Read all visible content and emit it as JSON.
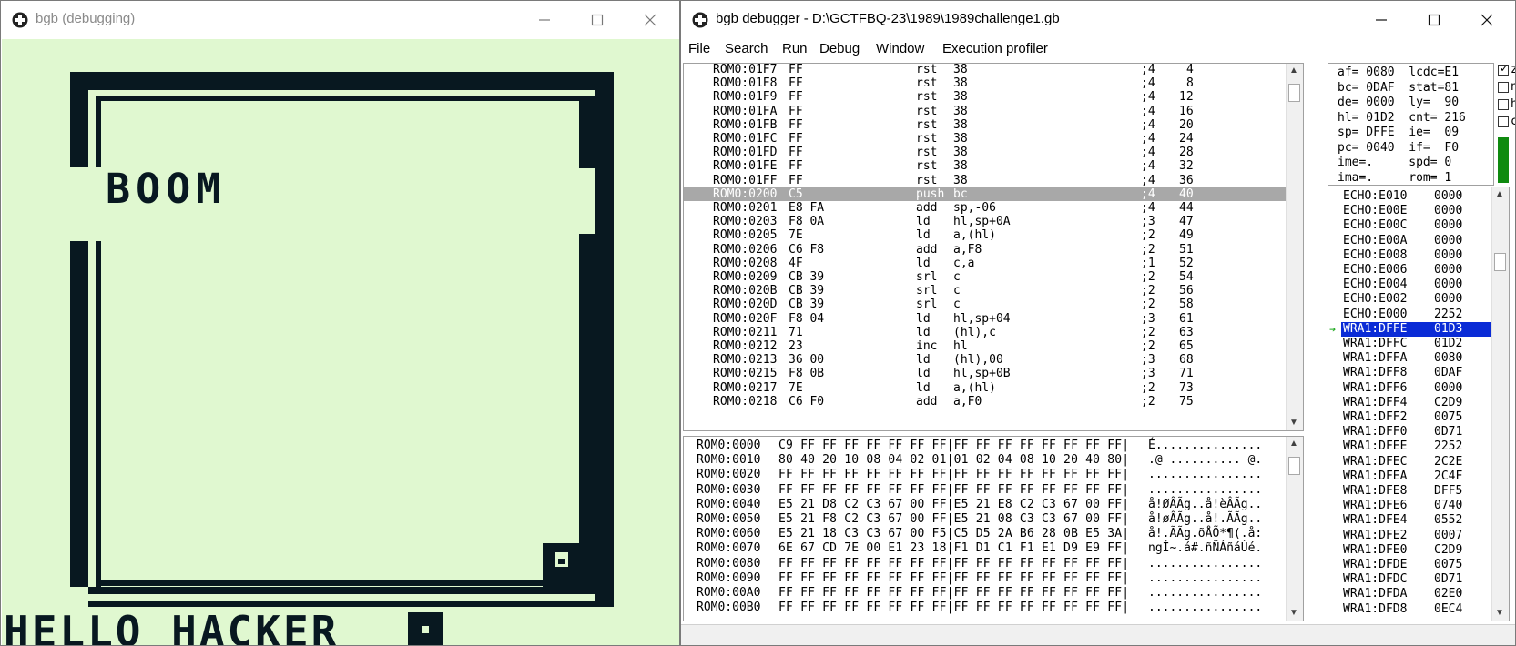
{
  "emulator": {
    "title": "bgb (debugging)",
    "screen_text": {
      "boom": "BOOM",
      "hello": "HELLO HACKER"
    }
  },
  "debugger": {
    "title": "bgb debugger - D:\\GCTFBQ-23\\1989\\1989challenge1.gb",
    "menu": [
      "File",
      "Search",
      "Run",
      "Debug",
      "Window",
      "Execution profiler"
    ],
    "disassembly": [
      {
        "addr": "ROM0:01F7",
        "bytes": "FF",
        "op": "rst",
        "args": "38",
        "cyc": ";4",
        "cnt": "4"
      },
      {
        "addr": "ROM0:01F8",
        "bytes": "FF",
        "op": "rst",
        "args": "38",
        "cyc": ";4",
        "cnt": "8"
      },
      {
        "addr": "ROM0:01F9",
        "bytes": "FF",
        "op": "rst",
        "args": "38",
        "cyc": ";4",
        "cnt": "12"
      },
      {
        "addr": "ROM0:01FA",
        "bytes": "FF",
        "op": "rst",
        "args": "38",
        "cyc": ";4",
        "cnt": "16"
      },
      {
        "addr": "ROM0:01FB",
        "bytes": "FF",
        "op": "rst",
        "args": "38",
        "cyc": ";4",
        "cnt": "20"
      },
      {
        "addr": "ROM0:01FC",
        "bytes": "FF",
        "op": "rst",
        "args": "38",
        "cyc": ";4",
        "cnt": "24"
      },
      {
        "addr": "ROM0:01FD",
        "bytes": "FF",
        "op": "rst",
        "args": "38",
        "cyc": ";4",
        "cnt": "28"
      },
      {
        "addr": "ROM0:01FE",
        "bytes": "FF",
        "op": "rst",
        "args": "38",
        "cyc": ";4",
        "cnt": "32"
      },
      {
        "addr": "ROM0:01FF",
        "bytes": "FF",
        "op": "rst",
        "args": "38",
        "cyc": ";4",
        "cnt": "36"
      },
      {
        "addr": "ROM0:0200",
        "bytes": "C5",
        "op": "push",
        "args": "bc",
        "cyc": ";4",
        "cnt": "40",
        "current": true
      },
      {
        "addr": "ROM0:0201",
        "bytes": "E8 FA",
        "op": "add",
        "args": "sp,-06",
        "cyc": ";4",
        "cnt": "44"
      },
      {
        "addr": "ROM0:0203",
        "bytes": "F8 0A",
        "op": "ld",
        "args": "hl,sp+0A",
        "cyc": ";3",
        "cnt": "47"
      },
      {
        "addr": "ROM0:0205",
        "bytes": "7E",
        "op": "ld",
        "args": "a,(hl)",
        "cyc": ";2",
        "cnt": "49"
      },
      {
        "addr": "ROM0:0206",
        "bytes": "C6 F8",
        "op": "add",
        "args": "a,F8",
        "cyc": ";2",
        "cnt": "51"
      },
      {
        "addr": "ROM0:0208",
        "bytes": "4F",
        "op": "ld",
        "args": "c,a",
        "cyc": ";1",
        "cnt": "52"
      },
      {
        "addr": "ROM0:0209",
        "bytes": "CB 39",
        "op": "srl",
        "args": "c",
        "cyc": ";2",
        "cnt": "54"
      },
      {
        "addr": "ROM0:020B",
        "bytes": "CB 39",
        "op": "srl",
        "args": "c",
        "cyc": ";2",
        "cnt": "56"
      },
      {
        "addr": "ROM0:020D",
        "bytes": "CB 39",
        "op": "srl",
        "args": "c",
        "cyc": ";2",
        "cnt": "58"
      },
      {
        "addr": "ROM0:020F",
        "bytes": "F8 04",
        "op": "ld",
        "args": "hl,sp+04",
        "cyc": ";3",
        "cnt": "61"
      },
      {
        "addr": "ROM0:0211",
        "bytes": "71",
        "op": "ld",
        "args": "(hl),c",
        "cyc": ";2",
        "cnt": "63"
      },
      {
        "addr": "ROM0:0212",
        "bytes": "23",
        "op": "inc",
        "args": "hl",
        "cyc": ";2",
        "cnt": "65"
      },
      {
        "addr": "ROM0:0213",
        "bytes": "36 00",
        "op": "ld",
        "args": "(hl),00",
        "cyc": ";3",
        "cnt": "68"
      },
      {
        "addr": "ROM0:0215",
        "bytes": "F8 0B",
        "op": "ld",
        "args": "hl,sp+0B",
        "cyc": ";3",
        "cnt": "71"
      },
      {
        "addr": "ROM0:0217",
        "bytes": "7E",
        "op": "ld",
        "args": "a,(hl)",
        "cyc": ";2",
        "cnt": "73"
      },
      {
        "addr": "ROM0:0218",
        "bytes": "C6 F0",
        "op": "add",
        "args": "a,F0",
        "cyc": ";2",
        "cnt": "75"
      }
    ],
    "hexdump": [
      {
        "addr": "ROM0:0000",
        "hex": "C9 FF FF FF FF FF FF FF|FF FF FF FF FF FF FF FF|",
        "ascii": "É..............."
      },
      {
        "addr": "ROM0:0010",
        "hex": "80 40 20 10 08 04 02 01|01 02 04 08 10 20 40 80|",
        "ascii": ".@ .......... @."
      },
      {
        "addr": "ROM0:0020",
        "hex": "FF FF FF FF FF FF FF FF|FF FF FF FF FF FF FF FF|",
        "ascii": "................"
      },
      {
        "addr": "ROM0:0030",
        "hex": "FF FF FF FF FF FF FF FF|FF FF FF FF FF FF FF FF|",
        "ascii": "................"
      },
      {
        "addr": "ROM0:0040",
        "hex": "E5 21 D8 C2 C3 67 00 FF|E5 21 E8 C2 C3 67 00 FF|",
        "ascii": "å!ØÂÃg..å!èÂÃg.."
      },
      {
        "addr": "ROM0:0050",
        "hex": "E5 21 F8 C2 C3 67 00 FF|E5 21 08 C3 C3 67 00 FF|",
        "ascii": "å!øÂÃg..å!.ÃÃg.."
      },
      {
        "addr": "ROM0:0060",
        "hex": "E5 21 18 C3 C3 67 00 F5|C5 D5 2A B6 28 0B E5 3A|",
        "ascii": "å!.ÃÃg.õÅÕ*¶(.å:"
      },
      {
        "addr": "ROM0:0070",
        "hex": "6E 67 CD 7E 00 E1 23 18|F1 D1 C1 F1 E1 D9 E9 FF|",
        "ascii": "ngÍ~.á#.ñÑÁñáÙé."
      },
      {
        "addr": "ROM0:0080",
        "hex": "FF FF FF FF FF FF FF FF|FF FF FF FF FF FF FF FF|",
        "ascii": "................"
      },
      {
        "addr": "ROM0:0090",
        "hex": "FF FF FF FF FF FF FF FF|FF FF FF FF FF FF FF FF|",
        "ascii": "................"
      },
      {
        "addr": "ROM0:00A0",
        "hex": "FF FF FF FF FF FF FF FF|FF FF FF FF FF FF FF FF|",
        "ascii": "................"
      },
      {
        "addr": "ROM0:00B0",
        "hex": "FF FF FF FF FF FF FF FF|FF FF FF FF FF FF FF FF|",
        "ascii": "................"
      }
    ],
    "registers": [
      "af= 0080  lcdc=E1",
      "bc= 0DAF  stat=81",
      "de= 0000  ly=  90",
      "hl= 01D2  cnt= 216",
      "sp= DFFE  ie=  09",
      "pc= 0040  if=  F0",
      "ime=.     spd= 0",
      "ima=.     rom= 1"
    ],
    "flags": [
      {
        "label": "z",
        "checked": true
      },
      {
        "label": "n",
        "checked": false
      },
      {
        "label": "h",
        "checked": false
      },
      {
        "label": "c",
        "checked": false
      }
    ],
    "stack": [
      {
        "addr": "ECHO:E010",
        "val": "0000"
      },
      {
        "addr": "ECHO:E00E",
        "val": "0000"
      },
      {
        "addr": "ECHO:E00C",
        "val": "0000"
      },
      {
        "addr": "ECHO:E00A",
        "val": "0000"
      },
      {
        "addr": "ECHO:E008",
        "val": "0000"
      },
      {
        "addr": "ECHO:E006",
        "val": "0000"
      },
      {
        "addr": "ECHO:E004",
        "val": "0000"
      },
      {
        "addr": "ECHO:E002",
        "val": "0000"
      },
      {
        "addr": "ECHO:E000",
        "val": "2252"
      },
      {
        "addr": "WRA1:DFFE",
        "val": "01D3",
        "current": true
      },
      {
        "addr": "WRA1:DFFC",
        "val": "01D2"
      },
      {
        "addr": "WRA1:DFFA",
        "val": "0080"
      },
      {
        "addr": "WRA1:DFF8",
        "val": "0DAF"
      },
      {
        "addr": "WRA1:DFF6",
        "val": "0000"
      },
      {
        "addr": "WRA1:DFF4",
        "val": "C2D9"
      },
      {
        "addr": "WRA1:DFF2",
        "val": "0075"
      },
      {
        "addr": "WRA1:DFF0",
        "val": "0D71"
      },
      {
        "addr": "WRA1:DFEE",
        "val": "2252"
      },
      {
        "addr": "WRA1:DFEC",
        "val": "2C2E"
      },
      {
        "addr": "WRA1:DFEA",
        "val": "2C4F"
      },
      {
        "addr": "WRA1:DFE8",
        "val": "DFF5"
      },
      {
        "addr": "WRA1:DFE6",
        "val": "0740"
      },
      {
        "addr": "WRA1:DFE4",
        "val": "0552"
      },
      {
        "addr": "WRA1:DFE2",
        "val": "0007"
      },
      {
        "addr": "WRA1:DFE0",
        "val": "C2D9"
      },
      {
        "addr": "WRA1:DFDE",
        "val": "0075"
      },
      {
        "addr": "WRA1:DFDC",
        "val": "0D71"
      },
      {
        "addr": "WRA1:DFDA",
        "val": "02E0"
      },
      {
        "addr": "WRA1:DFD8",
        "val": "0EC4"
      }
    ],
    "colors": {
      "current_line": "#a8a8a8",
      "stack_selection": "#0a2bd6",
      "lcd_light": "#e0f8d0",
      "lcd_dark": "#081820"
    }
  }
}
